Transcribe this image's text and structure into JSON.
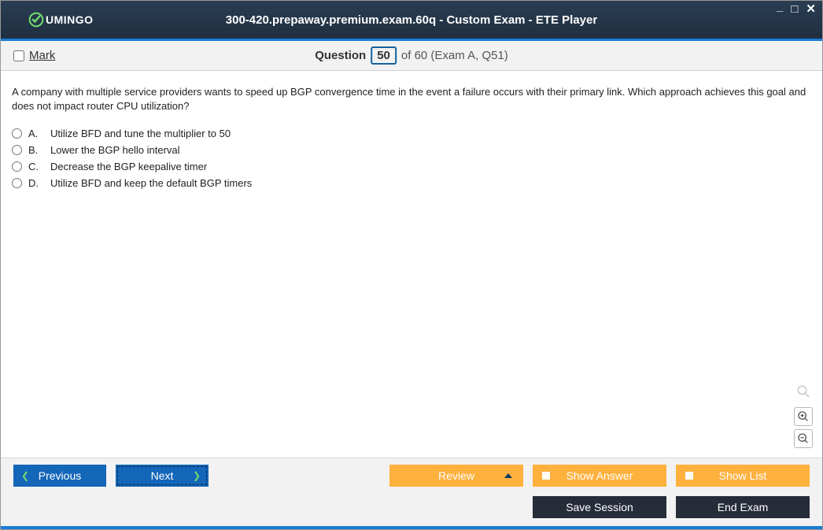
{
  "app": {
    "brand": "UMINGO",
    "title": "300-420.prepaway.premium.exam.60q - Custom Exam - ETE Player"
  },
  "header": {
    "mark_label": "Mark",
    "question_word": "Question",
    "current_num": "50",
    "of_text": "of 60 (Exam A, Q51)"
  },
  "question": {
    "text": "A company with multiple service providers wants to speed up BGP convergence time in the event a failure occurs with their primary link. Which approach achieves this goal and does not impact router CPU utilization?",
    "options": [
      {
        "letter": "A.",
        "text": "Utilize BFD and tune the multiplier to 50"
      },
      {
        "letter": "B.",
        "text": "Lower the BGP hello interval"
      },
      {
        "letter": "C.",
        "text": "Decrease the BGP keepalive timer"
      },
      {
        "letter": "D.",
        "text": "Utilize BFD and keep the default BGP timers"
      }
    ]
  },
  "footer": {
    "previous": "Previous",
    "next": "Next",
    "review": "Review",
    "show_answer": "Show Answer",
    "show_list": "Show List",
    "save_session": "Save Session",
    "end_exam": "End Exam"
  }
}
